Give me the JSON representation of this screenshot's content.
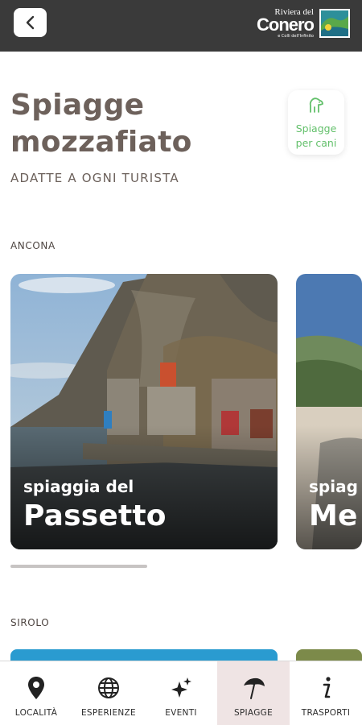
{
  "header": {
    "back_icon": "chevron-left-icon",
    "logo": {
      "line1": "Riviera del",
      "line2": "Conero",
      "line3": "e Colli dell'Infinito"
    }
  },
  "page": {
    "title_line1": "Spiagge",
    "title_line2": "mozzafiato",
    "subtitle": "ADATTE A OGNI TURISTA"
  },
  "dog_button": {
    "icon": "dog-icon",
    "label_line1": "Spiagge",
    "label_line2": "per cani",
    "color": "#63c06b"
  },
  "sections": [
    {
      "label": "ANCONA",
      "cards": [
        {
          "small": "spiaggia del",
          "big": "Passetto"
        },
        {
          "small": "spiag",
          "big": "Me"
        }
      ]
    },
    {
      "label": "SIROLO"
    }
  ],
  "nav": [
    {
      "icon": "map-pin-icon",
      "label": "LOCALITÀ",
      "active": false
    },
    {
      "icon": "globe-icon",
      "label": "ESPERIENZE",
      "active": false
    },
    {
      "icon": "sparkles-icon",
      "label": "EVENTI",
      "active": false
    },
    {
      "icon": "umbrella-icon",
      "label": "SPIAGGE",
      "active": true
    },
    {
      "icon": "info-icon",
      "label": "TRASPORTI",
      "active": false
    }
  ],
  "colors": {
    "topbar": "#3a3a3a",
    "title": "#6d615b",
    "accent_green": "#63c06b",
    "nav_active_bg": "#efe4e4"
  }
}
